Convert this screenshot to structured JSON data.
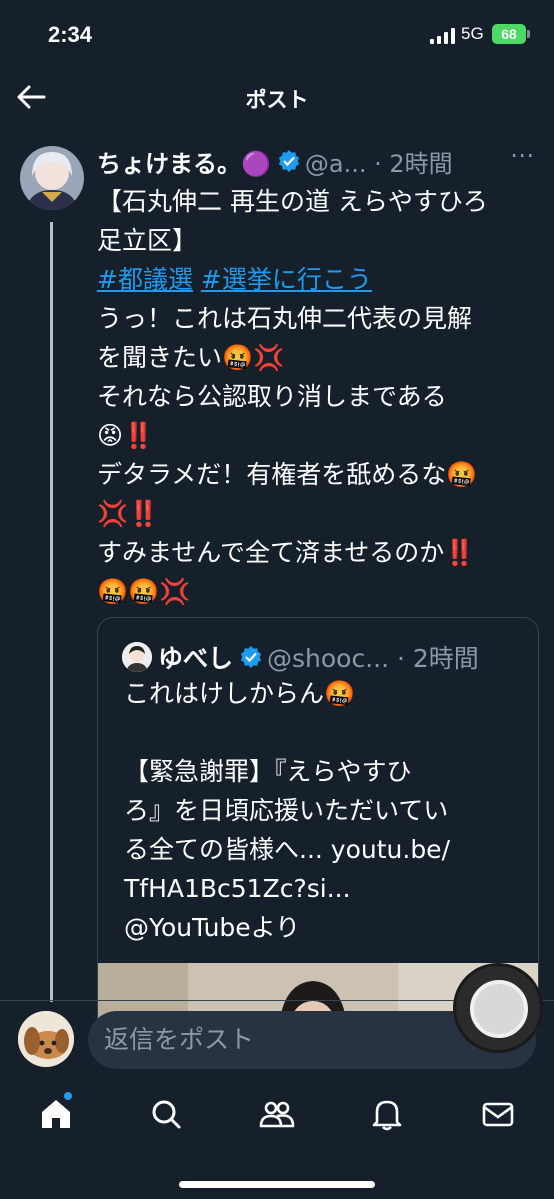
{
  "status_bar": {
    "time": "2:34",
    "network": "5G",
    "battery": "68"
  },
  "header": {
    "title": "ポスト"
  },
  "post": {
    "author_name": "ちょけまる。🟣",
    "handle_time": "@a... · 2時間",
    "more": "⋯",
    "lines": [
      "【石丸伸二 再生の道 えらやすひろ",
      "足立区】",
      "うっ！これは石丸伸二代表の見解",
      "を聞きたい🤬💢",
      "それなら公認取り消しまである",
      "😡‼️",
      "デタラメだ！有権者を舐めるな🤬",
      "💢‼️",
      "すみませんで全て済ませるのか‼️",
      "🤬🤬💢"
    ],
    "hashtags": [
      "#都議選",
      "#選挙に行こう"
    ]
  },
  "quote": {
    "author_name": "ゆべし",
    "handle_time": "@shooc... · 2時間",
    "lines": [
      "これはけしからん🤬",
      "",
      "【緊急謝罪】『えらやすひ",
      "ろ』を日頃応援いただいてい",
      "る全ての皆様へ... youtu.be/",
      "TfHA1Bc51Zc?si...",
      "@YouTubeより"
    ]
  },
  "reply": {
    "placeholder": "返信をポスト"
  },
  "tabs": [
    "home-icon",
    "search-icon",
    "communities-icon",
    "notifications-icon",
    "messages-icon"
  ],
  "colors": {
    "background": "#15202b",
    "accent": "#1d9bf0",
    "verified": "#1d9bf0",
    "secondary_text": "#8b98a5"
  }
}
